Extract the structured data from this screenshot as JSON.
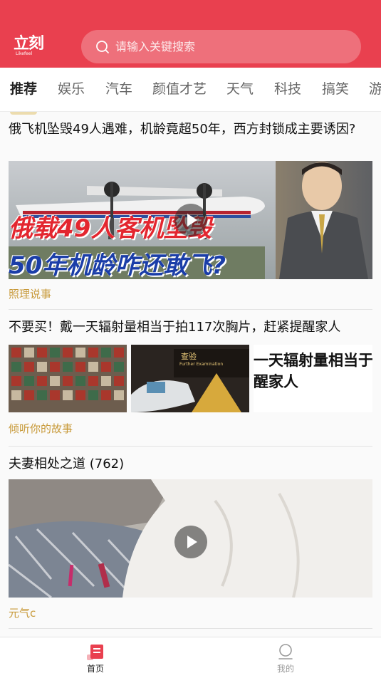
{
  "header": {
    "logo_text": "立刻",
    "logo_subtext": "Likefeel",
    "search_placeholder": "请输入关键搜索",
    "background": "#e9404f"
  },
  "tabs": [
    {
      "label": "推荐",
      "active": true
    },
    {
      "label": "娱乐",
      "active": false
    },
    {
      "label": "汽车",
      "active": false
    },
    {
      "label": "颜值才艺",
      "active": false
    },
    {
      "label": "天气",
      "active": false
    },
    {
      "label": "科技",
      "active": false
    },
    {
      "label": "搞笑",
      "active": false
    },
    {
      "label": "游",
      "active": false
    }
  ],
  "articles": [
    {
      "title": "俄飞机坠毁49人遇难，机龄竟超50年，西方封锁成主要诱因?",
      "source": "照理说事",
      "type": "video",
      "thumb_text_line1": "俄载49人客机坠毁",
      "thumb_text_line2": "50年机龄咋还敢飞?"
    },
    {
      "title": "不要买！戴一天辐射量相当于拍117次胸片，赶紧提醒家人",
      "source": "倾听你的故事",
      "type": "three-images",
      "thumb_label_a": "查验",
      "thumb_label_b": "Further Examination",
      "thumb_text": "一天辐射量相当于拍",
      "thumb_text2": "醒家人"
    },
    {
      "title": "夫妻相处之道 (762)",
      "source": "元气c",
      "type": "video"
    }
  ],
  "bottom_nav": [
    {
      "label": "首页",
      "icon": "home-news-icon",
      "active": true
    },
    {
      "label": "我的",
      "icon": "profile-icon",
      "active": false
    }
  ],
  "colors": {
    "accent": "#e9404f",
    "source_text": "#c89a3a",
    "nav_inactive": "#999999"
  }
}
